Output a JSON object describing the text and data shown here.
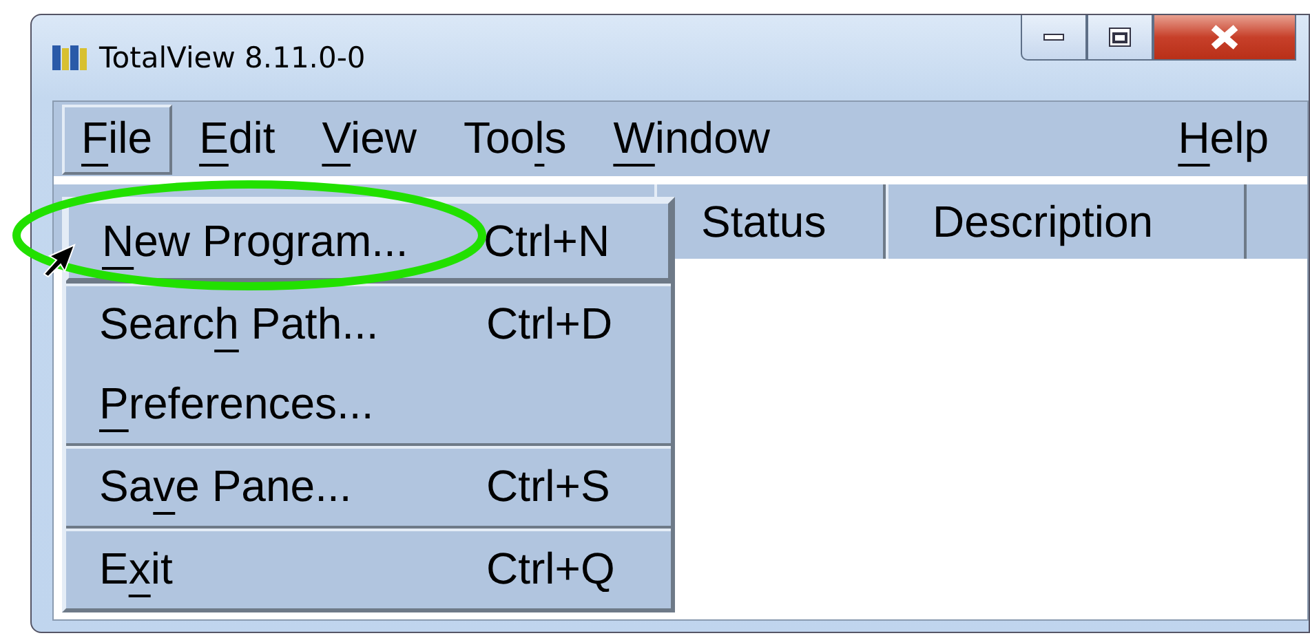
{
  "window": {
    "title": "TotalView 8.11.0-0"
  },
  "menubar": [
    {
      "label": {
        "key": "F",
        "after": "ile"
      },
      "selected": true
    },
    {
      "label": {
        "key": "E",
        "after": "dit"
      },
      "selected": false
    },
    {
      "label": {
        "key": "V",
        "after": "iew"
      },
      "selected": false
    },
    {
      "label": {
        "before": "Too",
        "key": "l",
        "after": "s"
      },
      "selected": false
    },
    {
      "label": {
        "key": "W",
        "after": "indow"
      },
      "selected": false
    },
    {
      "label": {
        "key": "H",
        "after": "elp"
      },
      "selected": false
    }
  ],
  "file_menu": {
    "sections": [
      [
        {
          "label": {
            "key": "N",
            "after": "ew Program..."
          },
          "shortcut": "Ctrl+N"
        }
      ],
      [
        {
          "label": {
            "before": "Searc",
            "key": "h",
            "after": " Path..."
          },
          "shortcut": "Ctrl+D"
        },
        {
          "label": {
            "key": "P",
            "after": "references..."
          }
        }
      ],
      [
        {
          "label": {
            "before": "Sa",
            "key": "v",
            "after": "e Pane..."
          },
          "shortcut": "Ctrl+S"
        }
      ],
      [
        {
          "label": {
            "before": "E",
            "key": "x",
            "after": "it"
          },
          "shortcut": "Ctrl+Q"
        }
      ]
    ]
  },
  "table": {
    "columns": [
      "Status",
      "Description"
    ]
  }
}
